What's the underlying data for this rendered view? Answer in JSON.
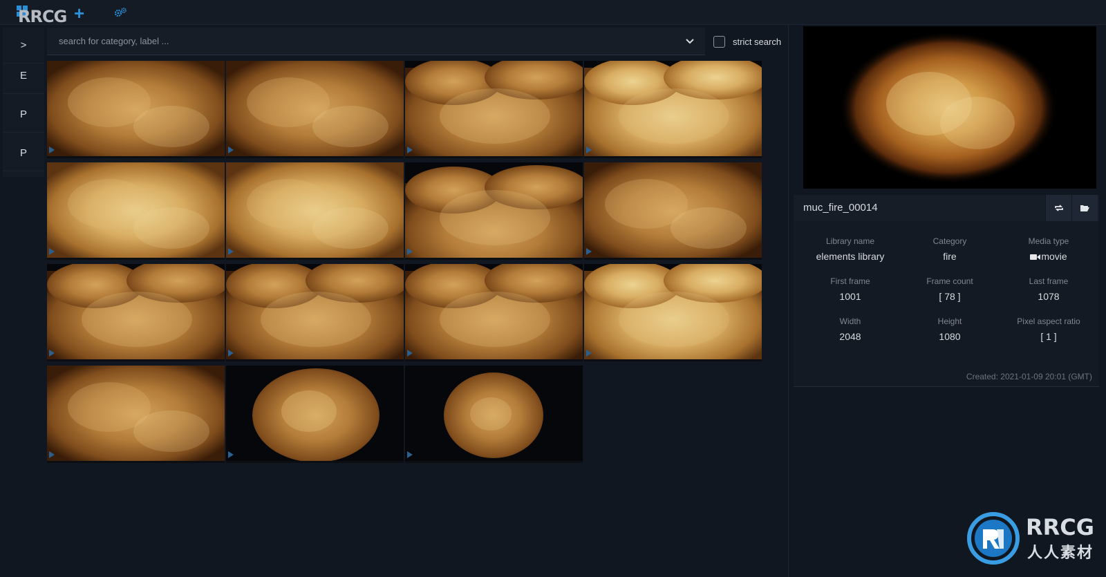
{
  "app": {
    "logo_text": "RRCG",
    "settings_icon": "gear-icon"
  },
  "sidebar": {
    "items": [
      {
        "label": ">",
        "icon": "expand-chevron-icon"
      },
      {
        "label": "E"
      },
      {
        "label": "P"
      },
      {
        "label": "P"
      }
    ]
  },
  "search": {
    "placeholder": "search for category, label ...",
    "value": "",
    "strict_label": "strict search",
    "strict_checked": false
  },
  "thumbnails": [
    {
      "style": "full-smoke"
    },
    {
      "style": "full-smoke"
    },
    {
      "style": "billow"
    },
    {
      "style": "billow-bright"
    },
    {
      "style": "full-bright"
    },
    {
      "style": "full-bright"
    },
    {
      "style": "billow-low"
    },
    {
      "style": "full-smoke"
    },
    {
      "style": "billow"
    },
    {
      "style": "billow"
    },
    {
      "style": "billow"
    },
    {
      "style": "billow-bright"
    },
    {
      "style": "full-smoke"
    },
    {
      "style": "ball"
    },
    {
      "style": "ball-small"
    }
  ],
  "details": {
    "name": "muc_fire_00014",
    "actions": [
      {
        "icon": "refresh-icon"
      },
      {
        "icon": "folder-open-icon"
      }
    ],
    "fields": [
      {
        "label": "Library name",
        "value": "elements library"
      },
      {
        "label": "Category",
        "value": "fire"
      },
      {
        "label": "Media type",
        "value": "movie",
        "icon": "video-camera-icon"
      },
      {
        "label": "First frame",
        "value": "1001"
      },
      {
        "label": "Frame count",
        "value": "[ 78 ]"
      },
      {
        "label": "Last frame",
        "value": "1078"
      },
      {
        "label": "Width",
        "value": "2048"
      },
      {
        "label": "Height",
        "value": "1080"
      },
      {
        "label": "Pixel aspect ratio",
        "value": "[ 1 ]"
      }
    ],
    "created": "Created: 2021-01-09 20:01 (GMT)"
  },
  "watermark": {
    "brand": "RRCG",
    "brand_cn": "人人素材"
  },
  "colors": {
    "accent": "#2a8fd8",
    "background": "#111720",
    "panel": "#161d27"
  }
}
